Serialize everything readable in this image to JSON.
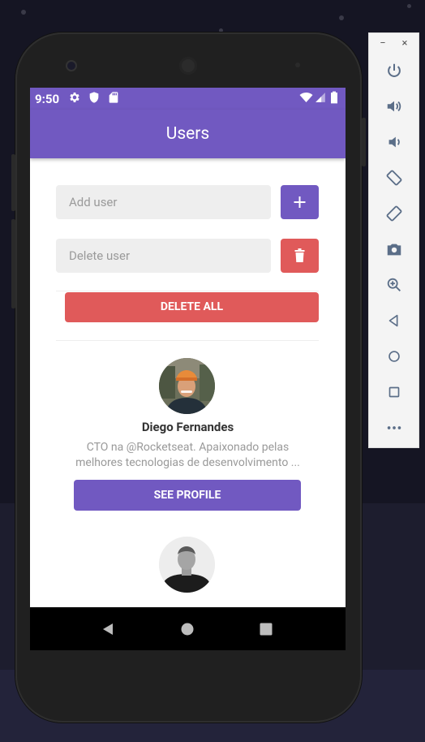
{
  "status_bar": {
    "time": "9:50"
  },
  "app_bar": {
    "title": "Users"
  },
  "form": {
    "add_placeholder": "Add user",
    "delete_placeholder": "Delete user",
    "delete_all_label": "DELETE ALL"
  },
  "users": [
    {
      "name": "Diego Fernandes",
      "bio": "CTO na @Rocketseat. Apaixonado pelas\nmelhores tecnologias de desenvolvimento ...",
      "button_label": "SEE PROFILE"
    },
    {
      "name": "",
      "bio": "",
      "button_label": ""
    }
  ],
  "nav": {
    "back": "back",
    "home": "home",
    "recents": "recents"
  },
  "emulator_panel": {
    "minimize": "−",
    "close": "×",
    "buttons": [
      "power-icon",
      "volume-up-icon",
      "volume-down-icon",
      "rotate-left-icon",
      "rotate-right-icon",
      "camera-icon",
      "zoom-icon",
      "back-icon",
      "home-icon",
      "overview-icon",
      "more-icon"
    ]
  },
  "colors": {
    "primary": "#7159c1",
    "danger": "#e05a5a",
    "input_bg": "#eeeeee"
  }
}
